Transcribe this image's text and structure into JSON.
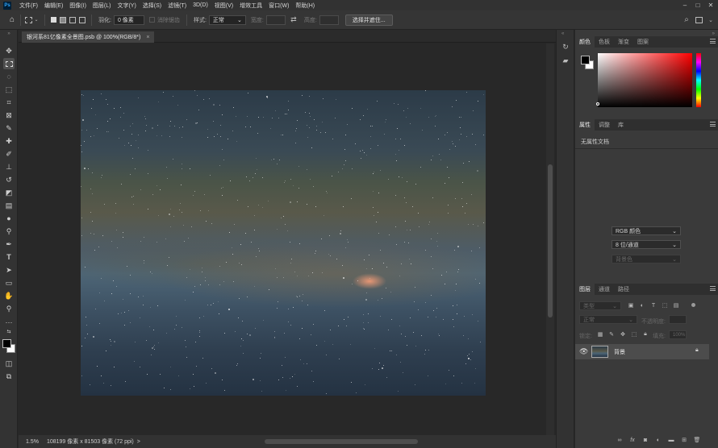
{
  "app": {
    "logo": "Ps"
  },
  "menu": [
    "文件(F)",
    "编辑(E)",
    "图像(I)",
    "图层(L)",
    "文字(Y)",
    "选择(S)",
    "滤镜(T)",
    "3D(D)",
    "视图(V)",
    "增效工具",
    "窗口(W)",
    "帮助(H)"
  ],
  "options": {
    "feather_label": "羽化:",
    "feather_value": "0 像素",
    "antialias_label": "消除锯齿",
    "style_label": "样式:",
    "style_value": "正常",
    "width_label": "宽度:",
    "height_label": "高度:",
    "select_mask_button": "选择并遮住..."
  },
  "document": {
    "tab_title": "银河系81亿像素全景图.psb @ 100%(RGB/8*)",
    "close": "×"
  },
  "status": {
    "zoom": "1.5%",
    "dimensions": "108199 像素 x 81503 像素 (72 ppi)",
    "arrow": ">"
  },
  "color_panel": {
    "tabs": [
      "颜色",
      "色板",
      "渐变",
      "图案"
    ],
    "accent_fg": "#000000",
    "accent_bg": "#ffffff",
    "hue": "#ff0000"
  },
  "properties_panel": {
    "tabs": [
      "属性",
      "调整",
      "库"
    ],
    "subtitle": "无属性文档",
    "mode_value": "RGB 颜色",
    "depth_value": "8 位/通道",
    "background_value": "背景色"
  },
  "layers_panel": {
    "tabs": [
      "图层",
      "通道",
      "路径"
    ],
    "filter_kind": "类型",
    "blend_mode": "正常",
    "opacity_label": "不透明度:",
    "lock_label": "锁定:",
    "fill_label": "填充:",
    "fill_value": "100%",
    "layers": [
      {
        "name": "背景",
        "visible": true,
        "locked": true
      }
    ]
  }
}
